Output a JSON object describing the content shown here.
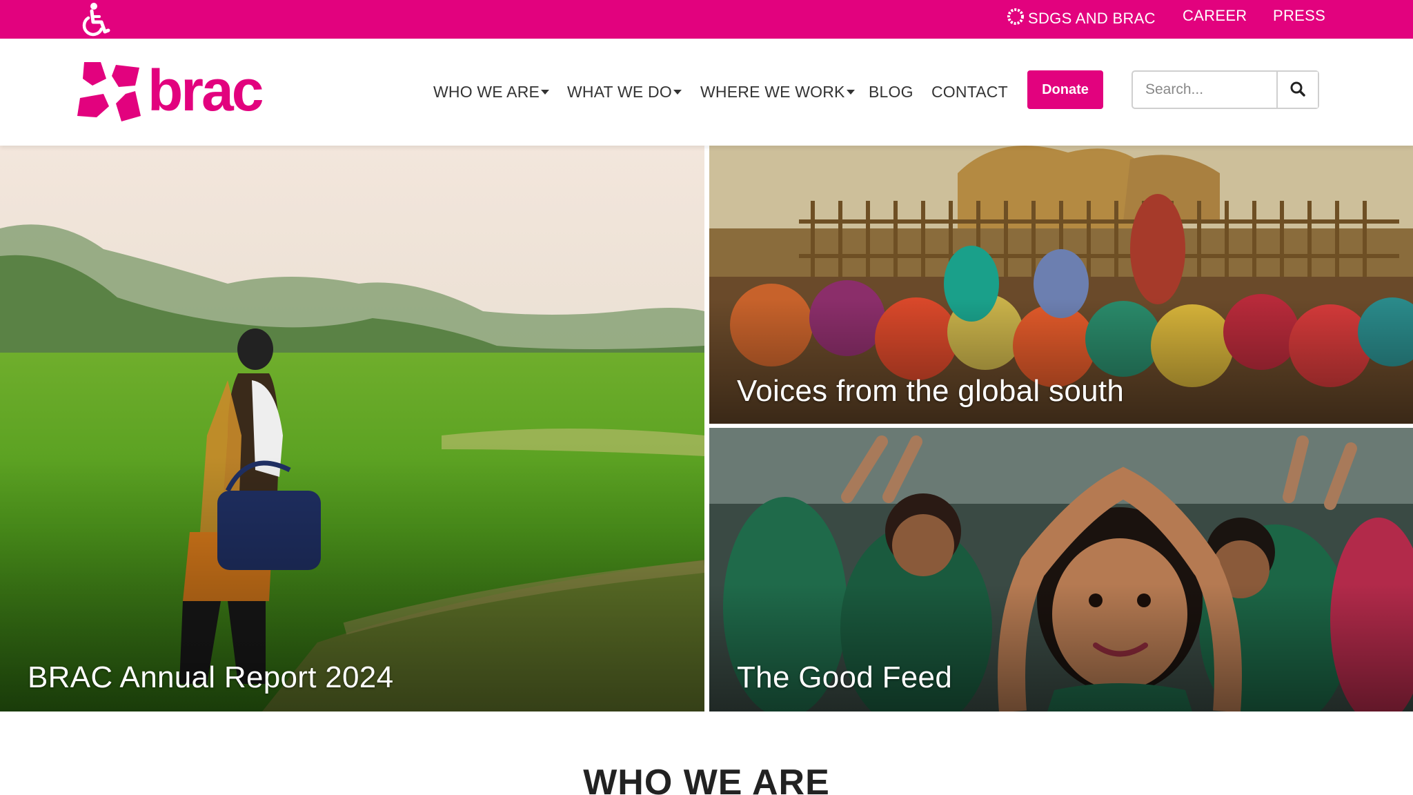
{
  "topbar": {
    "accessibility_icon": "wheelchair-accessibility-icon",
    "links": {
      "sdgs": "SDGS AND BRAC",
      "career": "CAREER",
      "press": "PRESS"
    },
    "background": "#e2027e"
  },
  "header": {
    "logo_text": "brac",
    "nav": {
      "who": "WHO WE ARE",
      "what": "WHAT WE DO",
      "where": "WHERE WE WORK",
      "blog": "BLOG",
      "contact": "CONTACT"
    },
    "donate_label": "Donate",
    "search_placeholder": "Search...",
    "search_icon": "magnifier-icon"
  },
  "hero": {
    "main_caption": "BRAC Annual Report 2024",
    "top_right_caption": "Voices from the global south",
    "bottom_right_caption": "The Good Feed"
  },
  "section": {
    "title": "WHO WE ARE"
  },
  "colors": {
    "brand": "#e2027e",
    "text": "#333333"
  }
}
